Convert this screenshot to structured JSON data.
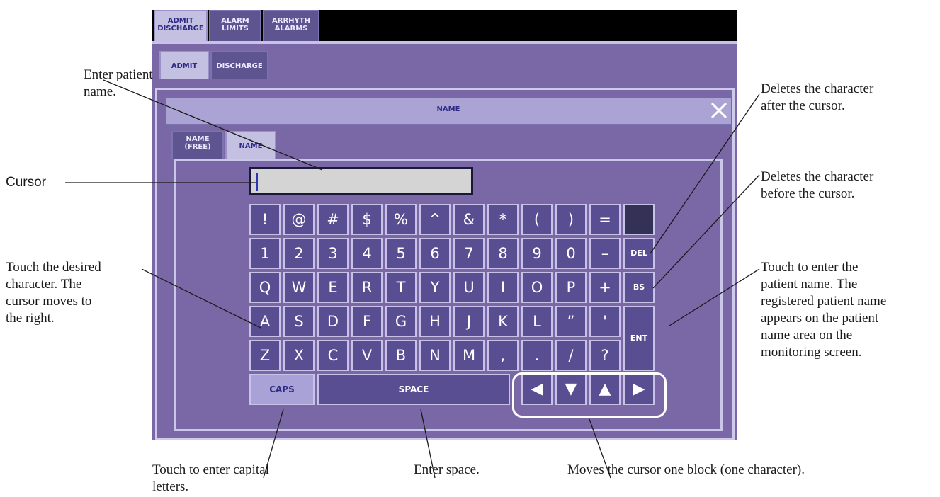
{
  "screen": {
    "top_tabs": [
      {
        "label": "ADMIT\nDISCHARGE",
        "active": true
      },
      {
        "label": "ALARM\nLIMITS",
        "active": false
      },
      {
        "label": "ARRHYTH\nALARMS",
        "active": false
      }
    ],
    "sub_tabs": [
      {
        "label": "ADMIT",
        "active": true
      },
      {
        "label": "DISCHARGE",
        "active": false
      }
    ],
    "dialog": {
      "title": "NAME",
      "close_icon": "close-icon",
      "tabs": [
        {
          "label": "NAME\n(FREE)",
          "active": false
        },
        {
          "label": "NAME",
          "active": true
        }
      ],
      "input_value": ""
    },
    "keyboard": {
      "rows": [
        [
          "!",
          "@",
          "#",
          "$",
          "%",
          "^",
          "&",
          "*",
          "(",
          ")",
          "="
        ],
        [
          "1",
          "2",
          "3",
          "4",
          "5",
          "6",
          "7",
          "8",
          "9",
          "0",
          "–"
        ],
        [
          "Q",
          "W",
          "E",
          "R",
          "T",
          "Y",
          "U",
          "I",
          "O",
          "P",
          "+"
        ],
        [
          "A",
          "S",
          "D",
          "F",
          "G",
          "H",
          "J",
          "K",
          "L",
          "”",
          "'"
        ],
        [
          "Z",
          "X",
          "C",
          "V",
          "B",
          "N",
          "M",
          ",",
          ".",
          "/",
          "?"
        ]
      ],
      "del_label": "DEL",
      "bs_label": "BS",
      "ent_label": "ENT",
      "caps_label": "CAPS",
      "space_label": "SPACE",
      "arrows": [
        "◀",
        "▼",
        "▲",
        "▶"
      ]
    }
  },
  "annotations": {
    "enter_name": "Enter patient\nname.",
    "cursor": "Cursor",
    "touch_char": "Touch the desired\ncharacter. The\ncursor moves to\nthe right.",
    "del": "Deletes the character\nafter the cursor.",
    "bs": "Deletes the character\nbefore the cursor.",
    "ent": "Touch to enter the\npatient name. The\nregistered patient name\nappears on the patient\nname area on the\nmonitoring screen.",
    "caps": "Touch to enter capital\nletters.",
    "space": "Enter space.",
    "arrows": "Moves the cursor one block (one character)."
  },
  "colors": {
    "panel": "#7a67a6",
    "key": "#5a4e93",
    "active_tab": "#c4c0e2",
    "tab_text": "#2c2a86",
    "input_bg": "#d4d4d4",
    "cursor": "#2b33b8"
  }
}
